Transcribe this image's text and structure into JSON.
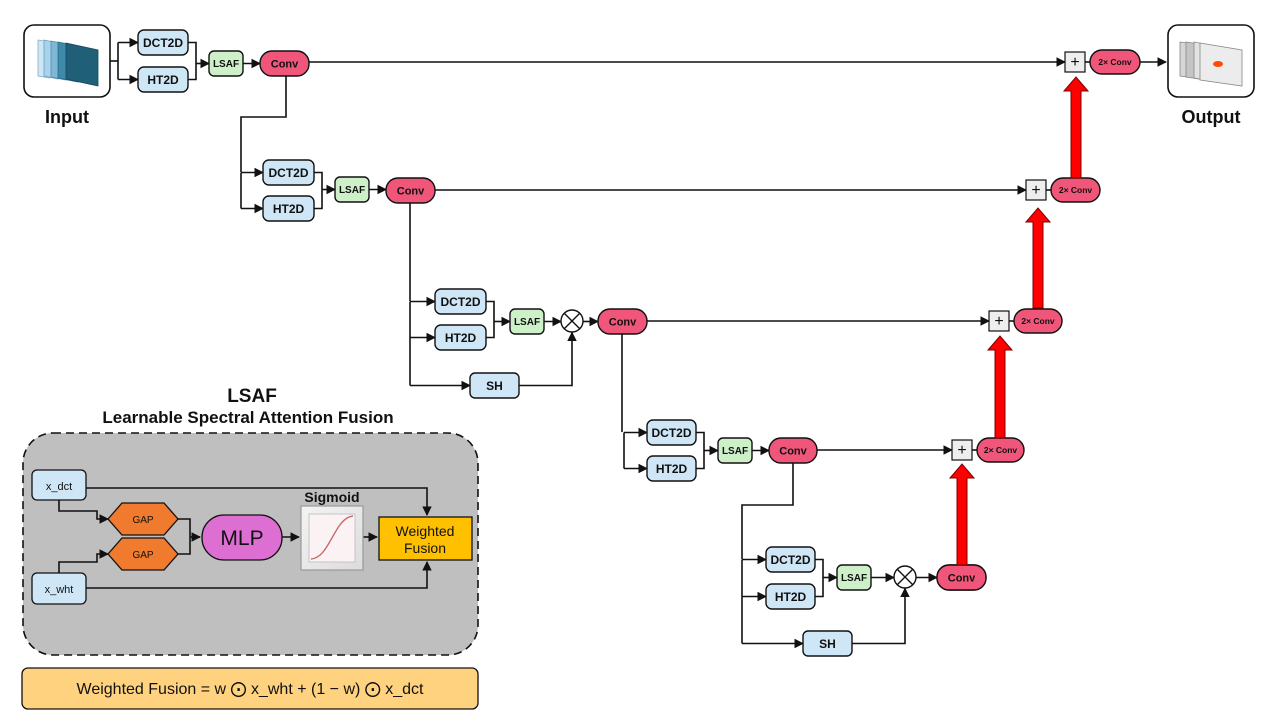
{
  "labels": {
    "input": "Input",
    "output": "Output",
    "dct": "DCT2D",
    "ht": "HT2D",
    "lsaf": "LSAF",
    "conv": "Conv",
    "conv2x": "2× Conv",
    "sh": "SH",
    "plus": "+"
  },
  "panel": {
    "title": "LSAF",
    "subtitle": "Learnable Spectral Attention Fusion",
    "x_dct": "x_dct",
    "x_wht": "x_wht",
    "gap": "GAP",
    "mlp": "MLP",
    "sigmoid": "Sigmoid",
    "weighted_line1": "Weighted",
    "weighted_line2": "Fusion"
  },
  "formula": "Weighted Fusion = w ⨀ x_wht + (1 − w) ⨀ x_dct",
  "colors": {
    "spectral": "#cfe6f7",
    "lsaf": "#cdf0c9",
    "conv": "#f0557a",
    "upsample": "#ff0000",
    "gap": "#f07a2e",
    "mlp": "#dd6ed2",
    "weighted": "#ffc000",
    "panel": "#bfbfbf",
    "formula": "#ffd280"
  }
}
